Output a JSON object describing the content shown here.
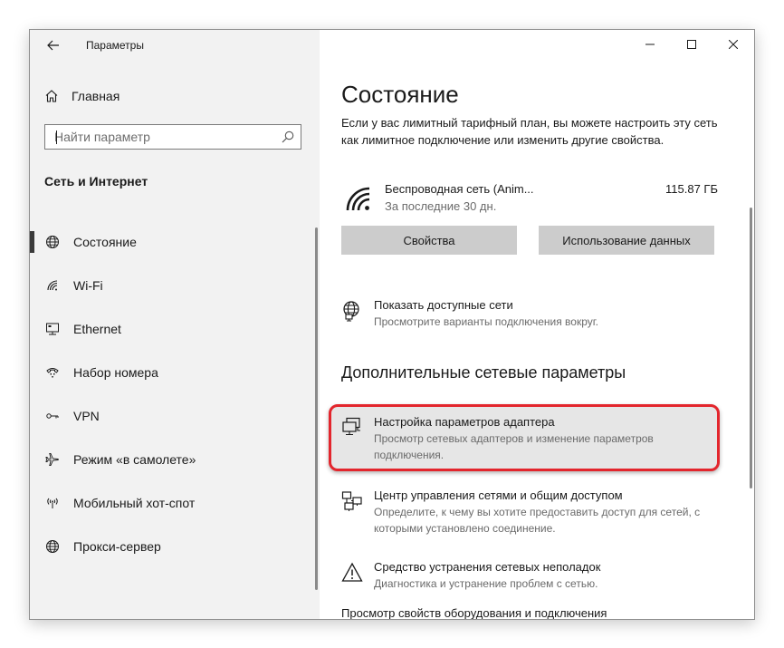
{
  "window": {
    "title": "Параметры"
  },
  "sidebar": {
    "home_label": "Главная",
    "search": {
      "value": "",
      "placeholder": "Найти параметр"
    },
    "section_title": "Сеть и Интернет",
    "items": [
      {
        "label": "Состояние",
        "icon": "globe-icon",
        "active": true
      },
      {
        "label": "Wi-Fi",
        "icon": "wifi-icon"
      },
      {
        "label": "Ethernet",
        "icon": "ethernet-icon"
      },
      {
        "label": "Набор номера",
        "icon": "dialup-icon"
      },
      {
        "label": "VPN",
        "icon": "vpn-icon"
      },
      {
        "label": "Режим «в самолете»",
        "icon": "airplane-icon"
      },
      {
        "label": "Мобильный хот-спот",
        "icon": "hotspot-icon"
      },
      {
        "label": "Прокси-сервер",
        "icon": "globe-icon"
      }
    ]
  },
  "main": {
    "title": "Состояние",
    "intro": "Если у вас лимитный тарифный план, вы можете настроить эту сеть как лимитное подключение или изменить другие свойства.",
    "network": {
      "name": "Беспроводная сеть (Anim...",
      "period": "За последние 30 дн.",
      "usage": "115.87 ГБ"
    },
    "buttons": {
      "properties": "Свойства",
      "data_usage": "Использование данных"
    },
    "show_networks": {
      "title": "Показать доступные сети",
      "desc": "Просмотрите варианты подключения вокруг."
    },
    "advanced_heading": "Дополнительные сетевые параметры",
    "advanced_items": [
      {
        "title": "Настройка параметров адаптера",
        "desc": "Просмотр сетевых адаптеров и изменение параметров подключения.",
        "highlighted": true
      },
      {
        "title": "Центр управления сетями и общим доступом",
        "desc": "Определите, к чему вы хотите предоставить доступ для сетей, с которыми установлено соединение."
      },
      {
        "title": "Средство устранения сетевых неполадок",
        "desc": "Диагностика и устранение проблем с сетью."
      }
    ],
    "bottom_link": "Просмотр свойств оборудования и подключения"
  },
  "colors": {
    "sidebar_bg": "#f2f2f2",
    "button_bg": "#cccccc",
    "highlight_border": "#e3262d",
    "highlight_bg": "#e6e6e6"
  }
}
